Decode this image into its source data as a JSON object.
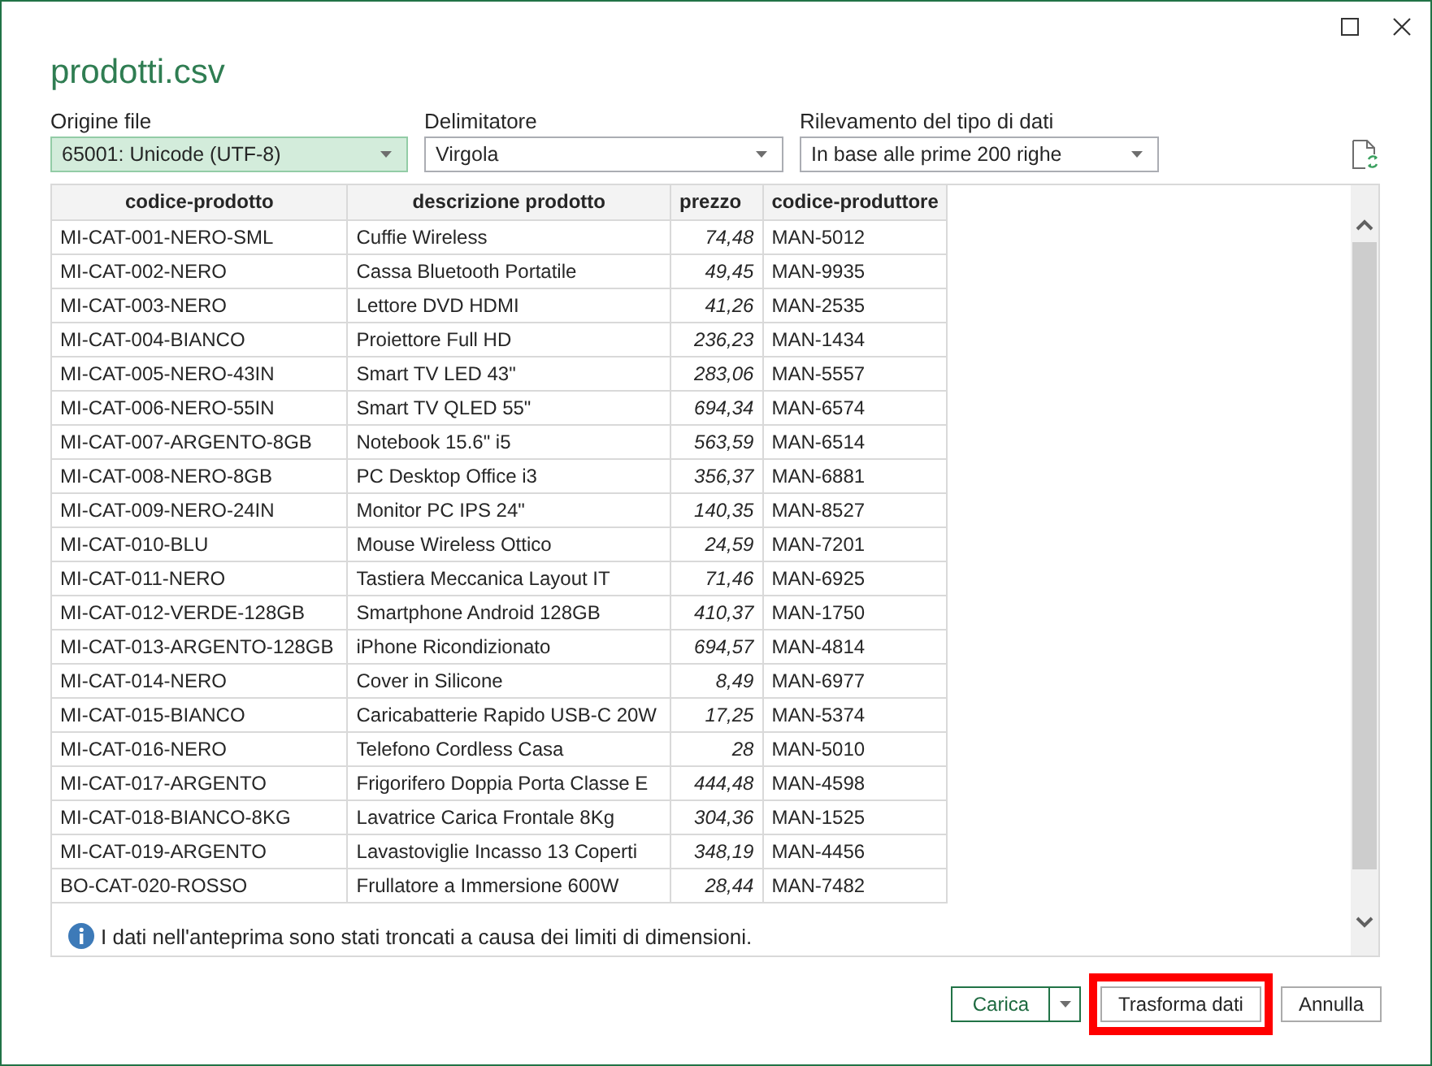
{
  "window": {
    "title": "prodotti.csv"
  },
  "settings": [
    {
      "label": "Origine file",
      "value": "65001: Unicode (UTF-8)",
      "focused": true
    },
    {
      "label": "Delimitatore",
      "value": "Virgola",
      "focused": false
    },
    {
      "label": "Rilevamento del tipo di dati",
      "value": "In base alle prime 200 righe",
      "focused": false
    }
  ],
  "preview": {
    "columns": [
      {
        "label": "codice-prodotto",
        "kind": "text",
        "header_centered": true
      },
      {
        "label": "descrizione prodotto",
        "kind": "text",
        "header_centered": true
      },
      {
        "label": "prezzo",
        "kind": "number",
        "header_centered": false
      },
      {
        "label": "codice-produttore",
        "kind": "text",
        "header_centered": false
      }
    ],
    "rows": [
      [
        "MI-CAT-001-NERO-SML",
        "Cuffie Wireless",
        "74,48",
        "MAN-5012"
      ],
      [
        "MI-CAT-002-NERO",
        "Cassa Bluetooth Portatile",
        "49,45",
        "MAN-9935"
      ],
      [
        "MI-CAT-003-NERO",
        "Lettore DVD HDMI",
        "41,26",
        "MAN-2535"
      ],
      [
        "MI-CAT-004-BIANCO",
        "Proiettore Full HD",
        "236,23",
        "MAN-1434"
      ],
      [
        "MI-CAT-005-NERO-43IN",
        "Smart TV LED 43\"",
        "283,06",
        "MAN-5557"
      ],
      [
        "MI-CAT-006-NERO-55IN",
        "Smart TV QLED 55\"",
        "694,34",
        "MAN-6574"
      ],
      [
        "MI-CAT-007-ARGENTO-8GB",
        "Notebook 15.6\" i5",
        "563,59",
        "MAN-6514"
      ],
      [
        "MI-CAT-008-NERO-8GB",
        "PC Desktop Office i3",
        "356,37",
        "MAN-6881"
      ],
      [
        "MI-CAT-009-NERO-24IN",
        "Monitor PC IPS 24\"",
        "140,35",
        "MAN-8527"
      ],
      [
        "MI-CAT-010-BLU",
        "Mouse Wireless Ottico",
        "24,59",
        "MAN-7201"
      ],
      [
        "MI-CAT-011-NERO",
        "Tastiera Meccanica Layout IT",
        "71,46",
        "MAN-6925"
      ],
      [
        "MI-CAT-012-VERDE-128GB",
        "Smartphone Android 128GB",
        "410,37",
        "MAN-1750"
      ],
      [
        "MI-CAT-013-ARGENTO-128GB",
        "iPhone Ricondizionato",
        "694,57",
        "MAN-4814"
      ],
      [
        "MI-CAT-014-NERO",
        "Cover in Silicone",
        "8,49",
        "MAN-6977"
      ],
      [
        "MI-CAT-015-BIANCO",
        "Caricabatterie Rapido USB-C 20W",
        "17,25",
        "MAN-5374"
      ],
      [
        "MI-CAT-016-NERO",
        "Telefono Cordless Casa",
        "28",
        "MAN-5010"
      ],
      [
        "MI-CAT-017-ARGENTO",
        "Frigorifero Doppia Porta Classe E",
        "444,48",
        "MAN-4598"
      ],
      [
        "MI-CAT-018-BIANCO-8KG",
        "Lavatrice Carica Frontale 8Kg",
        "304,36",
        "MAN-1525"
      ],
      [
        "MI-CAT-019-ARGENTO",
        "Lavastoviglie Incasso 13 Coperti",
        "348,19",
        "MAN-4456"
      ],
      [
        "BO-CAT-020-ROSSO",
        "Frullatore a Immersione 600W",
        "28,44",
        "MAN-7482"
      ]
    ],
    "notice": "I dati nell'anteprima sono stati troncati a causa dei limiti di dimensioni."
  },
  "buttons": [
    {
      "label": "Carica",
      "kind": "split",
      "default": true,
      "highlighted": false
    },
    {
      "label": "Trasforma dati",
      "kind": "plain",
      "default": false,
      "highlighted": true
    },
    {
      "label": "Annulla",
      "kind": "plain",
      "default": false,
      "highlighted": false
    }
  ]
}
